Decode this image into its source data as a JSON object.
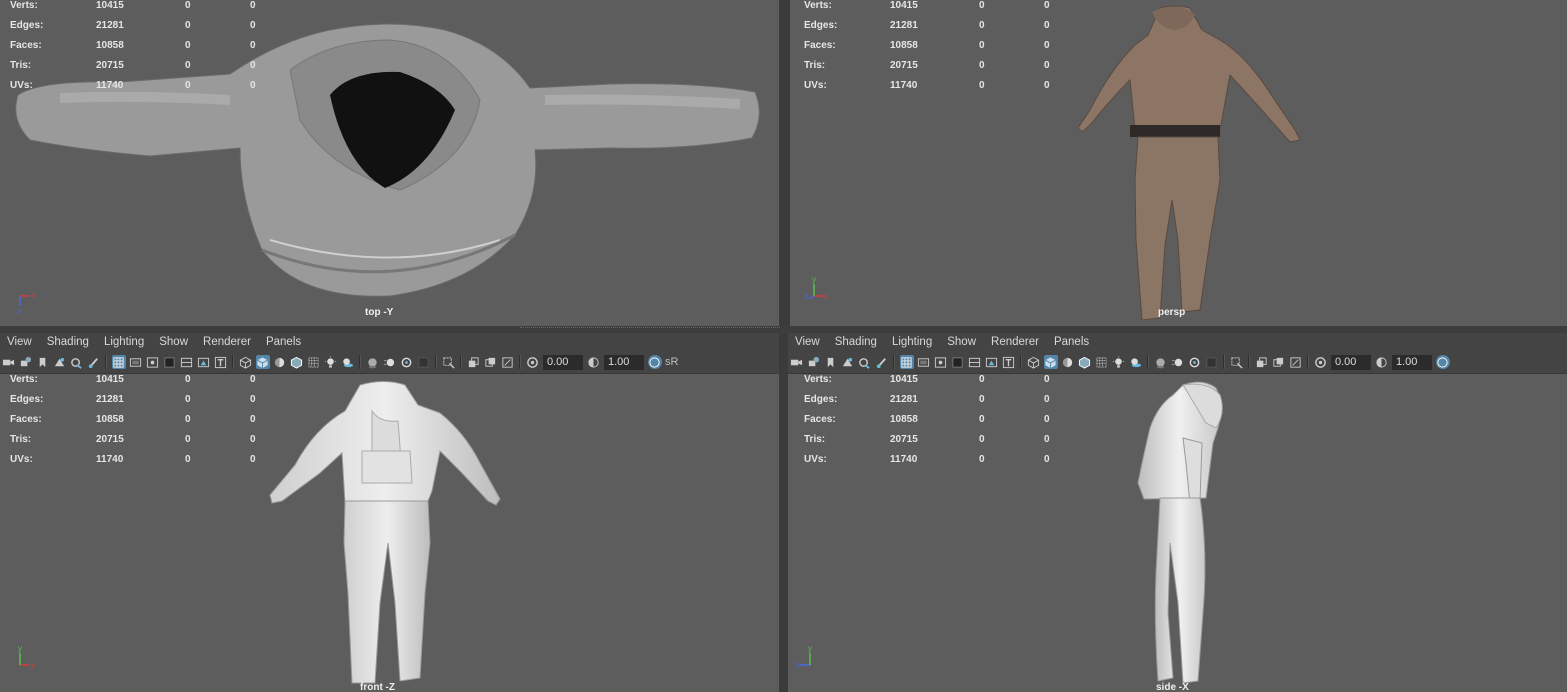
{
  "stats": {
    "rows": [
      {
        "label": "Verts:",
        "v1": "10415",
        "v2": "0",
        "v3": "0"
      },
      {
        "label": "Edges:",
        "v1": "21281",
        "v2": "0",
        "v3": "0"
      },
      {
        "label": "Faces:",
        "v1": "10858",
        "v2": "0",
        "v3": "0"
      },
      {
        "label": "Tris:",
        "v1": "20715",
        "v2": "0",
        "v3": "0"
      },
      {
        "label": "UVs:",
        "v1": "11740",
        "v2": "0",
        "v3": "0"
      }
    ]
  },
  "viewports": {
    "top": {
      "camera": "top -Y"
    },
    "persp": {
      "camera": "persp"
    },
    "front": {
      "camera": "front -Z"
    },
    "side": {
      "camera": "side -X"
    }
  },
  "menu": [
    "View",
    "Shading",
    "Lighting",
    "Show",
    "Renderer",
    "Panels"
  ],
  "toolbar": {
    "exposure": "0.00",
    "gamma": "1.00",
    "srgb_label": "sR"
  },
  "axes": {
    "x": "x",
    "y": "y",
    "z": "z"
  },
  "colors": {
    "viewport_bg": "#5d5d5d",
    "toolbar_bg": "#444444",
    "active_icon": "#5285a6",
    "x_axis": "#d43c3c",
    "y_axis": "#58c24e",
    "z_axis": "#4a66e0"
  }
}
